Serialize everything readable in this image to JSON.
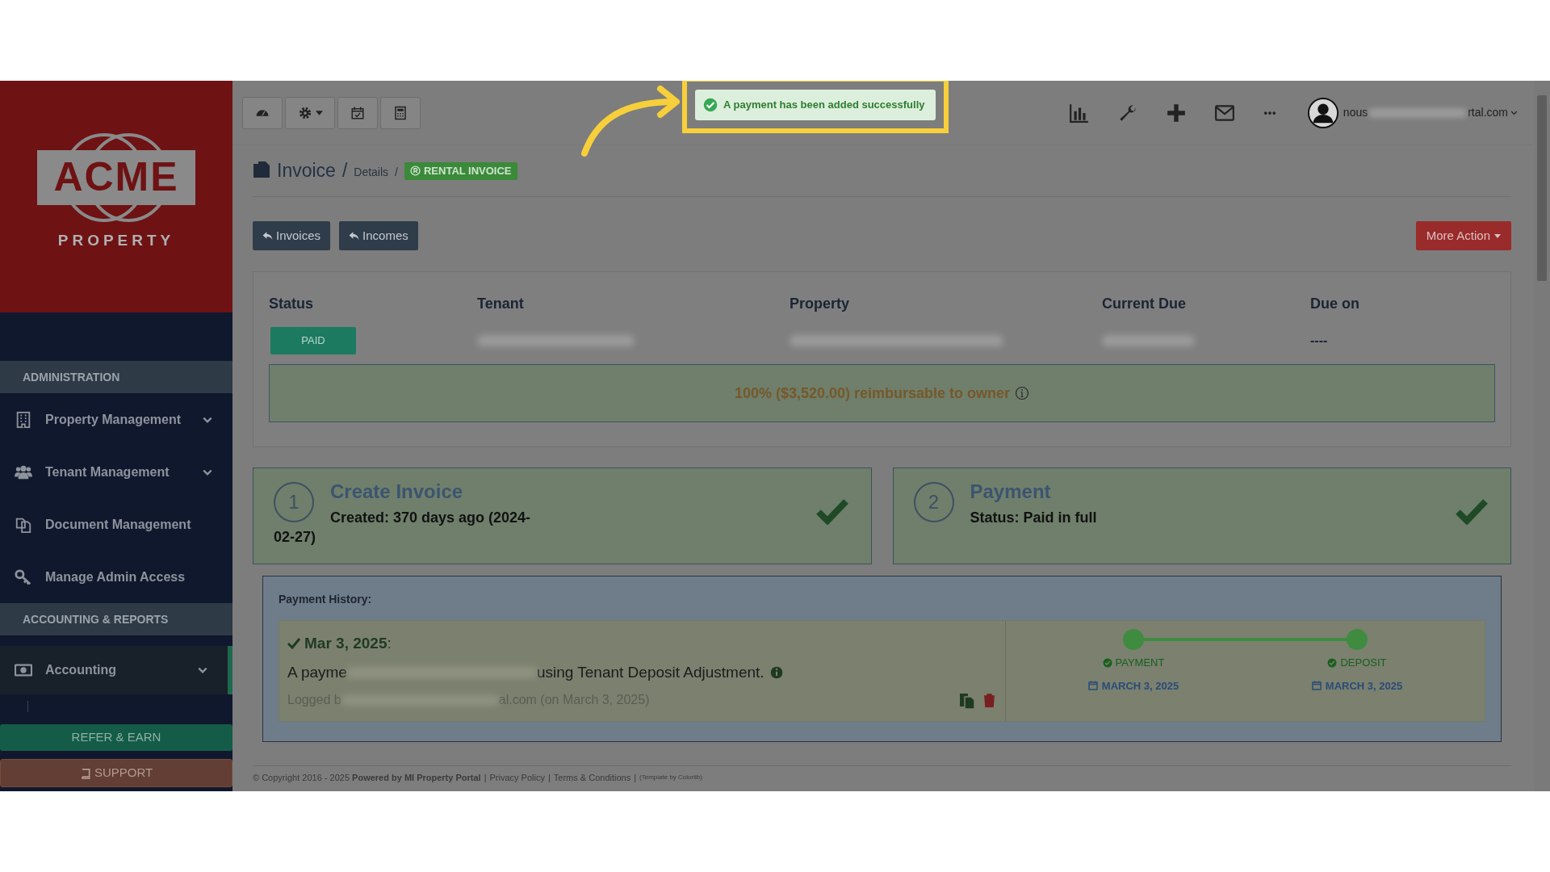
{
  "sidebar": {
    "logo": {
      "name": "ACME",
      "tagline": "PROPERTY"
    },
    "sections": [
      {
        "title": "ADMINISTRATION",
        "items": [
          {
            "label": "Property Management",
            "expandable": true,
            "selected": false
          },
          {
            "label": "Tenant Management",
            "expandable": true,
            "selected": false
          },
          {
            "label": "Document Management",
            "expandable": false,
            "selected": false
          },
          {
            "label": "Manage Admin Access",
            "expandable": false,
            "selected": false
          }
        ]
      },
      {
        "title": "ACCOUNTING & REPORTS",
        "items": [
          {
            "label": "Accounting",
            "expandable": true,
            "selected": true
          }
        ]
      }
    ],
    "refer_button": "REFER & EARN",
    "support_button": "SUPPORT"
  },
  "toast": {
    "text": "A payment has been added successfully"
  },
  "user": {
    "email_start": "nous",
    "email_end": "rtal.com"
  },
  "breadcrumb": {
    "title": "Invoice",
    "separator": "/",
    "details": "Details",
    "separator_2": "/",
    "badge": "RENTAL INVOICE"
  },
  "nav_buttons": [
    "Invoices",
    "Incomes"
  ],
  "more_action": "More Action",
  "summary": {
    "columns": [
      "Status",
      "Tenant",
      "Property",
      "Current Due",
      "Due on"
    ],
    "status": "PAID",
    "due_on": "----",
    "reimbursable": "100% ($3,520.00) reimbursable to owner"
  },
  "steps": [
    {
      "number": "1",
      "title": "Create Invoice",
      "detail": "Created: 370 days ago (2024-02-27)",
      "done": true
    },
    {
      "number": "2",
      "title": "Payment",
      "detail": "Status: Paid in full",
      "done": true
    }
  ],
  "payment_history": {
    "title": "Payment History:",
    "entries": [
      {
        "date": "**Mar 3, 2025**:",
        "description_start": "A payme",
        "description_end": "using Tenant Deposit Adjustment.",
        "logged_start": "Logged b",
        "logged_end": "al.com (on March 3, 2025)",
        "timeline": [
          {
            "label": "PAYMENT",
            "date": "MARCH 3, 2025"
          },
          {
            "label": "DEPOSIT",
            "date": "MARCH 3, 2025"
          }
        ]
      }
    ]
  },
  "footer": {
    "copyright": "© Copyright 2016 - 2025 **Powered by MI Property Portal**",
    "links": [
      "Privacy Policy",
      "Terms & Conditions"
    ],
    "separator": "|",
    "template": "(Template by Colorlib)"
  }
}
